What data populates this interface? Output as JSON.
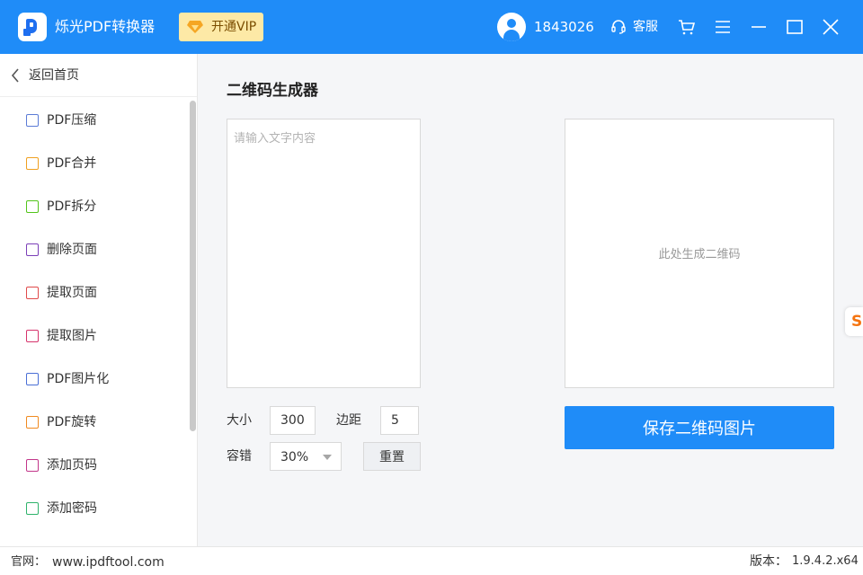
{
  "titlebar": {
    "app_name": "烁光PDF转换器",
    "vip_label": "开通VIP",
    "user_id": "1843026",
    "service_label": "客服"
  },
  "sidebar": {
    "back_label": "返回首页",
    "items": [
      {
        "label": "PDF压缩",
        "color": "#5b7bd6"
      },
      {
        "label": "PDF合并",
        "color": "#f0a020"
      },
      {
        "label": "PDF拆分",
        "color": "#52c41a"
      },
      {
        "label": "删除页面",
        "color": "#7b3fb8"
      },
      {
        "label": "提取页面",
        "color": "#e04a4a"
      },
      {
        "label": "提取图片",
        "color": "#d6336c"
      },
      {
        "label": "PDF图片化",
        "color": "#4a6fd6"
      },
      {
        "label": "PDF旋转",
        "color": "#f08a20"
      },
      {
        "label": "添加页码",
        "color": "#c2368a"
      },
      {
        "label": "添加密码",
        "color": "#2fb36b"
      }
    ]
  },
  "main": {
    "title": "二维码生成器",
    "text_placeholder": "请输入文字内容",
    "size_label": "大小",
    "size_value": "300",
    "margin_label": "边距",
    "margin_value": "5",
    "error_label": "容错",
    "error_value": "30%",
    "reset_label": "重置",
    "qr_placeholder": "此处生成二维码",
    "save_label": "保存二维码图片"
  },
  "statusbar": {
    "site_label": "官网：",
    "site_url": "www.ipdftool.com",
    "version_label": "版本：",
    "version": "1.9.4.2.x64"
  },
  "colors": {
    "accent": "#1f8cf8",
    "vip_bg": "#fde9a6"
  }
}
